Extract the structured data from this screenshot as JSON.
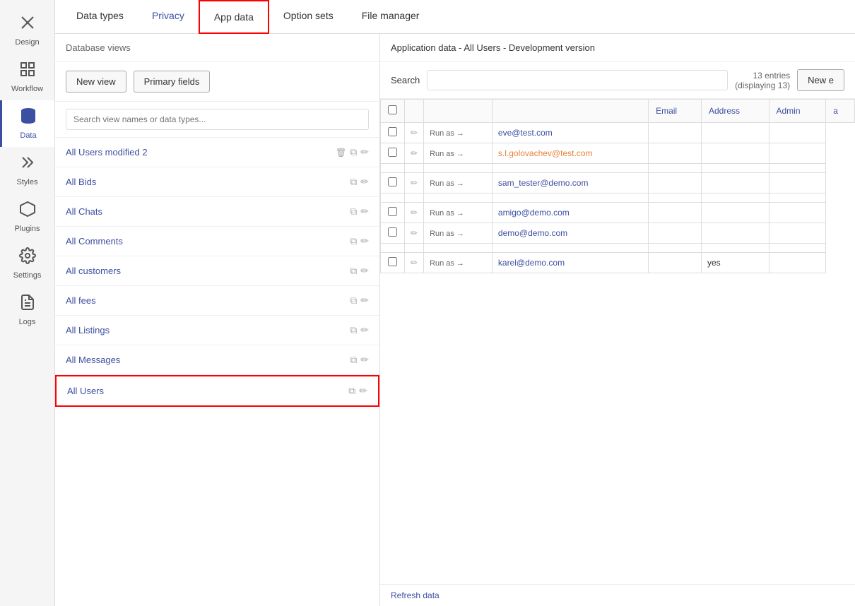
{
  "sidebar": {
    "items": [
      {
        "id": "design",
        "label": "Design",
        "icon": "✕",
        "active": false
      },
      {
        "id": "workflow",
        "label": "Workflow",
        "icon": "⊞",
        "active": false
      },
      {
        "id": "data",
        "label": "Data",
        "icon": "🗄",
        "active": true
      },
      {
        "id": "styles",
        "label": "Styles",
        "icon": "✏",
        "active": false
      },
      {
        "id": "plugins",
        "label": "Plugins",
        "icon": "⬡",
        "active": false
      },
      {
        "id": "settings",
        "label": "Settings",
        "icon": "⚙",
        "active": false
      },
      {
        "id": "logs",
        "label": "Logs",
        "icon": "📄",
        "active": false
      }
    ]
  },
  "tabs": [
    {
      "id": "data-types",
      "label": "Data types",
      "active": false
    },
    {
      "id": "privacy",
      "label": "Privacy",
      "active": false,
      "privacy": true
    },
    {
      "id": "app-data",
      "label": "App data",
      "active": true
    },
    {
      "id": "option-sets",
      "label": "Option sets",
      "active": false
    },
    {
      "id": "file-manager",
      "label": "File manager",
      "active": false
    }
  ],
  "left_panel": {
    "db_views_label": "Database views",
    "new_view_label": "New view",
    "primary_fields_label": "Primary fields",
    "search_placeholder": "Search view names or data types...",
    "views": [
      {
        "id": "all-users-modified",
        "name": "All Users modified 2",
        "active": false
      },
      {
        "id": "all-bids",
        "name": "All Bids",
        "active": false
      },
      {
        "id": "all-chats",
        "name": "All Chats",
        "active": false
      },
      {
        "id": "all-comments",
        "name": "All Comments",
        "active": false
      },
      {
        "id": "all-customers",
        "name": "All customers",
        "active": false
      },
      {
        "id": "all-fees",
        "name": "All fees",
        "active": false
      },
      {
        "id": "all-listings",
        "name": "All Listings",
        "active": false
      },
      {
        "id": "all-messages",
        "name": "All Messages",
        "active": false
      },
      {
        "id": "all-users",
        "name": "All Users",
        "active": true
      }
    ]
  },
  "right_panel": {
    "header": "Application data - All Users - Development version",
    "search_label": "Search",
    "search_placeholder": "",
    "entries_info": "13 entries\n(displaying 13)",
    "new_entry_label": "New e",
    "columns": [
      "Email",
      "Address",
      "Admin",
      "a"
    ],
    "rows": [
      {
        "id": 1,
        "run_as": "Run as →",
        "email": "eve@test.com",
        "email_type": "normal",
        "address": "",
        "admin": "",
        "extra": ""
      },
      {
        "id": 2,
        "run_as": "Run as →",
        "email": "s.l.golovachev@test.com",
        "email_type": "orange",
        "address": "",
        "admin": "",
        "extra": ""
      },
      {
        "id": 3,
        "run_as": "",
        "email": "",
        "email_type": "normal",
        "address": "",
        "admin": "",
        "extra": ""
      },
      {
        "id": 4,
        "run_as": "Run as →",
        "email": "sam_tester@demo.com",
        "email_type": "normal",
        "address": "",
        "admin": "",
        "extra": ""
      },
      {
        "id": 5,
        "run_as": "",
        "email": "",
        "email_type": "normal",
        "address": "",
        "admin": "",
        "extra": ""
      },
      {
        "id": 6,
        "run_as": "Run as →",
        "email": "amigo@demo.com",
        "email_type": "normal",
        "address": "",
        "admin": "",
        "extra": ""
      },
      {
        "id": 7,
        "run_as": "Run as →",
        "email": "demo@demo.com",
        "email_type": "normal",
        "address": "",
        "admin": "",
        "extra": ""
      },
      {
        "id": 8,
        "run_as": "",
        "email": "",
        "email_type": "normal",
        "address": "",
        "admin": "",
        "extra": ""
      },
      {
        "id": 9,
        "run_as": "Run as →",
        "email": "karel@demo.com",
        "email_type": "normal",
        "address": "",
        "admin": "yes",
        "extra": ""
      }
    ],
    "refresh_label": "Refresh data"
  }
}
